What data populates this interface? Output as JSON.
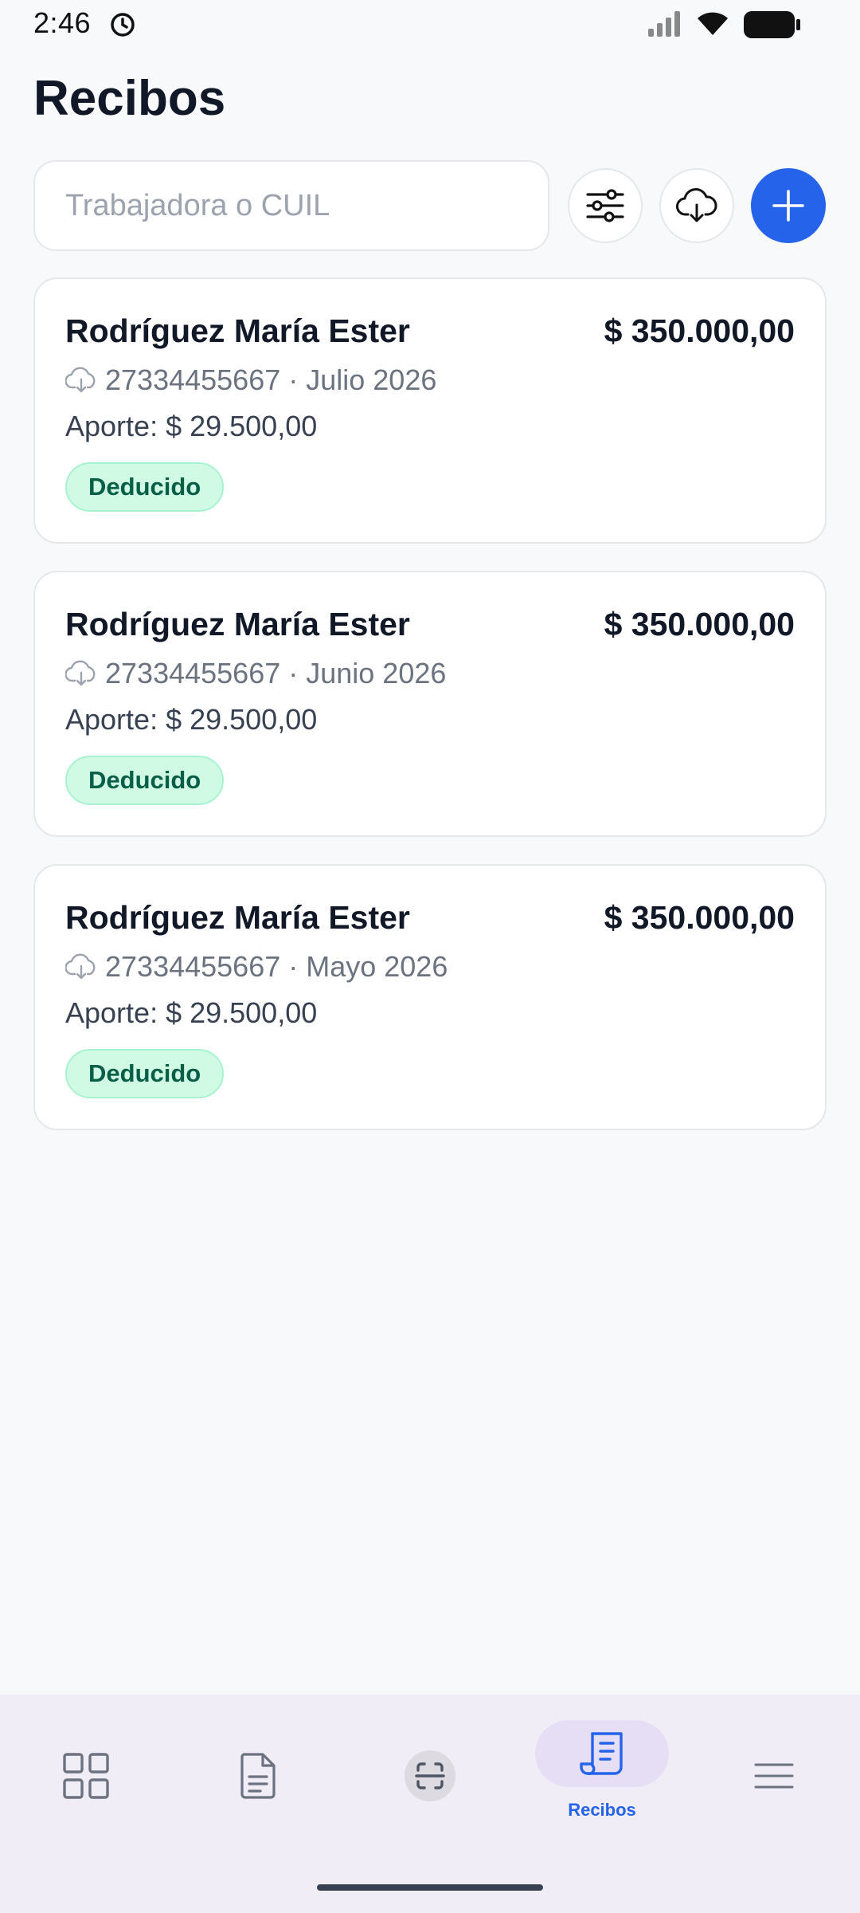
{
  "status_bar": {
    "time": "2:46"
  },
  "page": {
    "title": "Recibos"
  },
  "search": {
    "placeholder": "Trabajadora o CUIL",
    "value": ""
  },
  "actions": {
    "filter_icon": "sliders-icon",
    "download_icon": "cloud-download-icon",
    "add_icon": "plus-icon"
  },
  "receipts": [
    {
      "name": "Rodríguez María Ester",
      "amount": "$ 350.000,00",
      "meta": "27334455667 · Julio 2026",
      "contribution": "Aporte: $ 29.500,00",
      "status": "Deducido"
    },
    {
      "name": "Rodríguez María Ester",
      "amount": "$ 350.000,00",
      "meta": "27334455667 · Junio 2026",
      "contribution": "Aporte: $ 29.500,00",
      "status": "Deducido"
    },
    {
      "name": "Rodríguez María Ester",
      "amount": "$ 350.000,00",
      "meta": "27334455667 · Mayo 2026",
      "contribution": "Aporte: $ 29.500,00",
      "status": "Deducido"
    }
  ],
  "bottom_nav": {
    "items": [
      {
        "icon": "grid-icon",
        "label": ""
      },
      {
        "icon": "document-icon",
        "label": ""
      },
      {
        "icon": "scan-icon",
        "label": ""
      },
      {
        "icon": "receipt-icon",
        "label": "Recibos",
        "active": true
      },
      {
        "icon": "menu-icon",
        "label": ""
      }
    ]
  },
  "colors": {
    "accent": "#2563EB",
    "badge_bg": "#D1FAE5",
    "badge_text": "#065F46",
    "background": "#F8F9FB",
    "nav_background": "#F1EDF7"
  }
}
